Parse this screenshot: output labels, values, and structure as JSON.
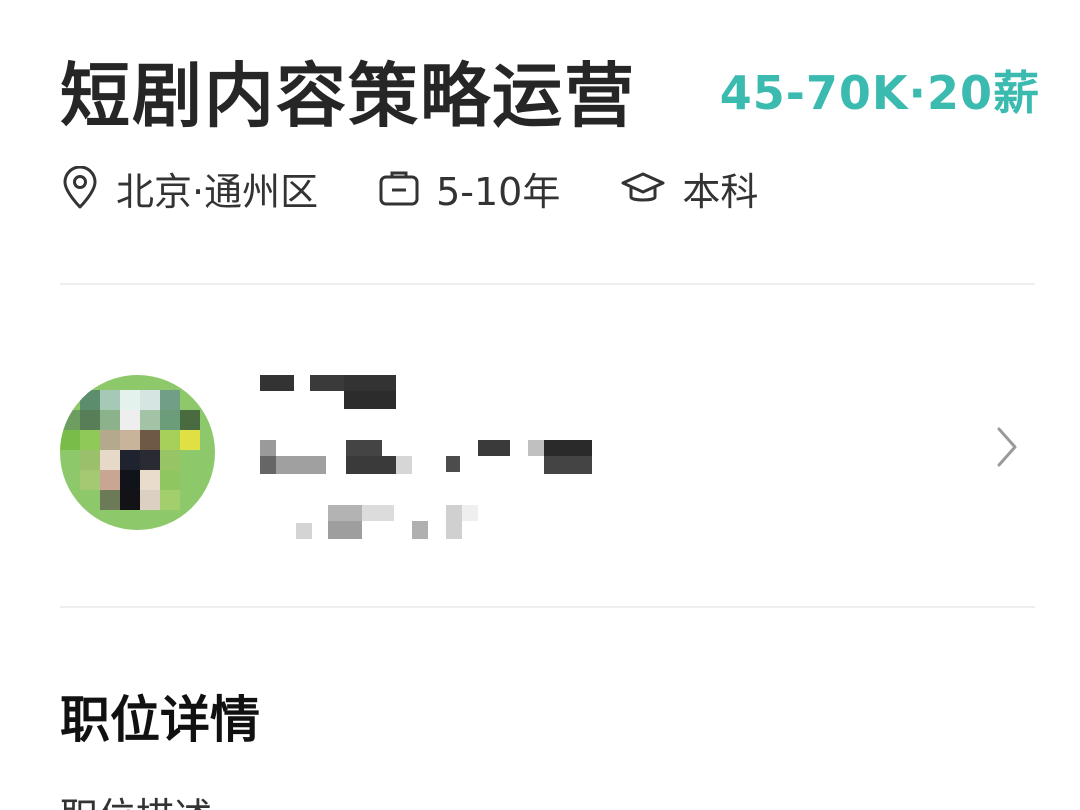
{
  "job": {
    "title": "短剧内容策略运营",
    "salary": "45-70K·20薪"
  },
  "meta": {
    "location": "北京·通州区",
    "experience": "5-10年",
    "education": "本科"
  },
  "icons": {
    "location": "location-pin-icon",
    "experience": "briefcase-icon",
    "education": "graduation-cap-icon",
    "chevron": "chevron-right-icon"
  },
  "colors": {
    "salary": "#3bbab0",
    "title": "#262626"
  },
  "section": {
    "title": "职位详情",
    "subtitle": "职位描述"
  }
}
